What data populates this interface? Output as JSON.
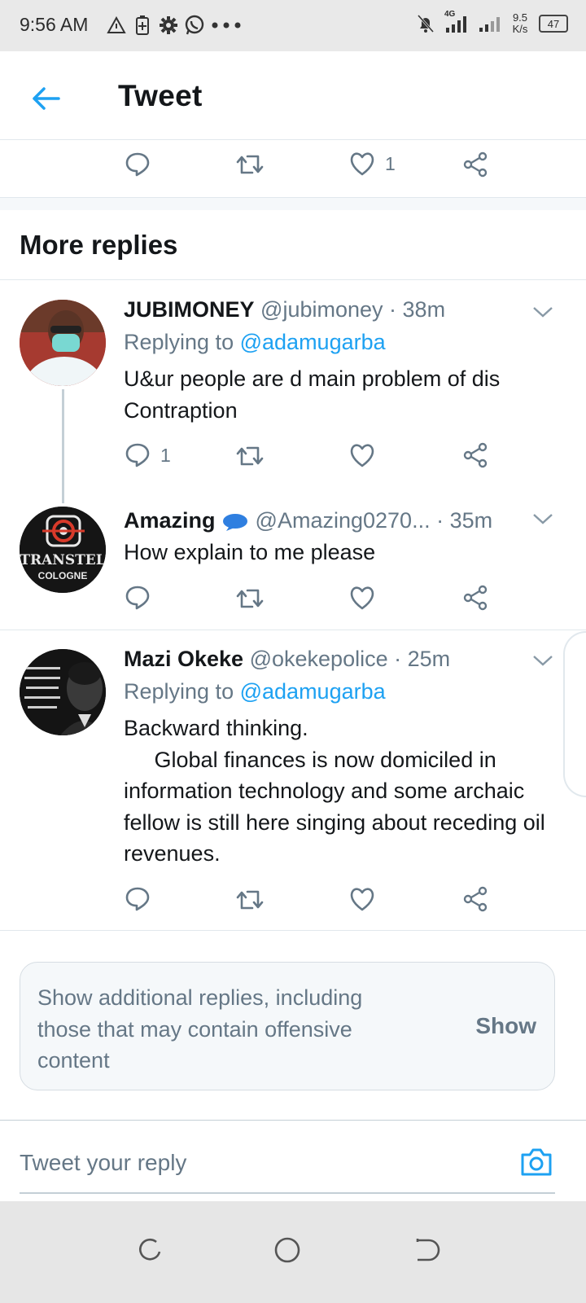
{
  "status_bar": {
    "time": "9:56 AM",
    "network_type": "4G",
    "net_rate_value": "9.5",
    "net_rate_unit": "K/s",
    "battery": "47"
  },
  "header": {
    "title": "Tweet"
  },
  "top_actions": {
    "like_count": "1"
  },
  "section": {
    "title": "More replies"
  },
  "tweets": [
    {
      "name": "JUBIMONEY",
      "handle": "@jubimoney",
      "time": "· 38m",
      "replying_prefix": "Replying to",
      "replying_to": "@adamugarba",
      "text": "U&ur people are d main problem of dis Contraption",
      "reply_count": "1"
    },
    {
      "name": "Amazing",
      "handle": "@Amazing0270...",
      "time": "· 35m",
      "text": "How explain to me please",
      "avatar_text_1": "TRANSTEL",
      "avatar_text_2": "COLOGNE"
    },
    {
      "name": "Mazi Okeke",
      "handle": "@okekepolice",
      "time": "· 25m",
      "replying_prefix": "Replying to",
      "replying_to": "@adamugarba",
      "text": "Backward thinking.\n     Global finances is now domiciled in information technology and some archaic fellow is still here singing about receding oil revenues."
    }
  ],
  "additional_replies": {
    "message": "Show additional replies, including those that may contain offensive content",
    "button": "Show"
  },
  "reply_input": {
    "placeholder": "Tweet your reply"
  },
  "colors": {
    "accent": "#1da1f2",
    "muted": "#657786",
    "text": "#14171a"
  }
}
